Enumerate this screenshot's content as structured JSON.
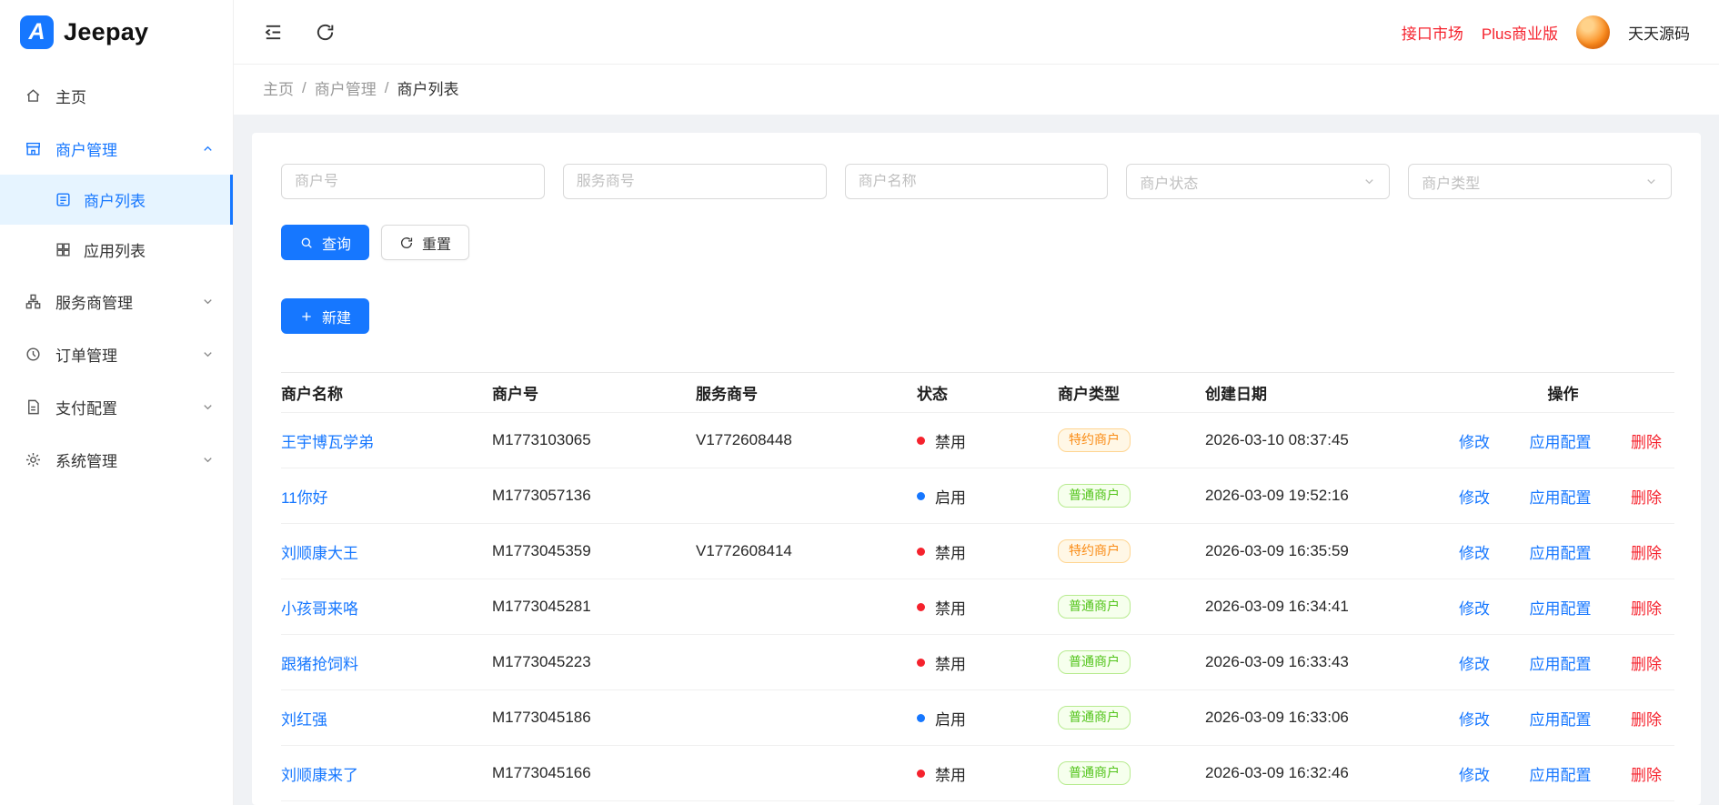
{
  "brand": {
    "logo_letter": "A",
    "name": "Jeepay"
  },
  "topbar": {
    "market_link": "接口市场",
    "plus_link": "Plus商业版",
    "username": "天天源码"
  },
  "breadcrumb": {
    "separator": "/",
    "items": [
      {
        "label": "主页"
      },
      {
        "label": "商户管理"
      },
      {
        "label": "商户列表"
      }
    ]
  },
  "sidebar": {
    "items": [
      {
        "label": "主页",
        "icon": "home-icon"
      },
      {
        "label": "商户管理",
        "icon": "shop-icon",
        "expanded": true,
        "children": [
          {
            "label": "商户列表",
            "icon": "list-icon",
            "active": true
          },
          {
            "label": "应用列表",
            "icon": "apps-icon"
          }
        ]
      },
      {
        "label": "服务商管理",
        "icon": "cluster-icon"
      },
      {
        "label": "订单管理",
        "icon": "order-icon"
      },
      {
        "label": "支付配置",
        "icon": "pay-icon"
      },
      {
        "label": "系统管理",
        "icon": "gear-icon"
      }
    ]
  },
  "filters": {
    "merchant_no": {
      "placeholder": "商户号"
    },
    "isv_no": {
      "placeholder": "服务商号"
    },
    "merchant_name": {
      "placeholder": "商户名称"
    },
    "merchant_status": {
      "placeholder": "商户状态"
    },
    "merchant_type": {
      "placeholder": "商户类型"
    },
    "search_label": "查询",
    "reset_label": "重置",
    "new_label": "新建"
  },
  "table": {
    "columns": [
      "商户名称",
      "商户号",
      "服务商号",
      "状态",
      "商户类型",
      "创建日期",
      "操作"
    ],
    "actions": [
      {
        "label": "修改",
        "name": "edit",
        "danger": false
      },
      {
        "label": "应用配置",
        "name": "app-config",
        "danger": false
      },
      {
        "label": "删除",
        "name": "delete",
        "danger": true
      }
    ],
    "rows": [
      {
        "name": "王宇博瓦学弟",
        "merchant_no": "M1773103065",
        "isv_no": "V1772608448",
        "status": "禁用",
        "enabled": false,
        "type": "特约商户",
        "type_tag": "orange",
        "created": "2026-03-10 08:37:45"
      },
      {
        "name": "11你好",
        "merchant_no": "M1773057136",
        "isv_no": "",
        "status": "启用",
        "enabled": true,
        "type": "普通商户",
        "type_tag": "green",
        "created": "2026-03-09 19:52:16"
      },
      {
        "name": "刘顺康大王",
        "merchant_no": "M1773045359",
        "isv_no": "V1772608414",
        "status": "禁用",
        "enabled": false,
        "type": "特约商户",
        "type_tag": "orange",
        "created": "2026-03-09 16:35:59"
      },
      {
        "name": "小孩哥来咯",
        "merchant_no": "M1773045281",
        "isv_no": "",
        "status": "禁用",
        "enabled": false,
        "type": "普通商户",
        "type_tag": "green",
        "created": "2026-03-09 16:34:41"
      },
      {
        "name": "跟猪抢饲料",
        "merchant_no": "M1773045223",
        "isv_no": "",
        "status": "禁用",
        "enabled": false,
        "type": "普通商户",
        "type_tag": "green",
        "created": "2026-03-09 16:33:43"
      },
      {
        "name": "刘红强",
        "merchant_no": "M1773045186",
        "isv_no": "",
        "status": "启用",
        "enabled": true,
        "type": "普通商户",
        "type_tag": "green",
        "created": "2026-03-09 16:33:06"
      },
      {
        "name": "刘顺康来了",
        "merchant_no": "M1773045166",
        "isv_no": "",
        "status": "禁用",
        "enabled": false,
        "type": "普通商户",
        "type_tag": "green",
        "created": "2026-03-09 16:32:46"
      }
    ]
  },
  "colors": {
    "primary": "#1677ff",
    "danger": "#f5222d",
    "tag_orange": "#fa8c16",
    "tag_green": "#52c41a",
    "sidebar_active_bg": "#e6f4ff",
    "page_bg": "#f0f2f5"
  }
}
